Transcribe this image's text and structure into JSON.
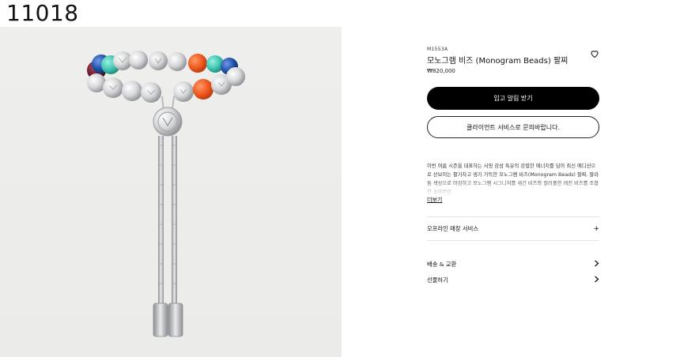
{
  "page": {
    "id_label": "11018"
  },
  "product": {
    "sku": "M1553A",
    "title": "모노그램 비즈 (Monogram Beads) 팔찌",
    "price": "₩820,000"
  },
  "actions": {
    "wishlist_icon": "heart-icon",
    "notify_label": "입고 알림 받기",
    "contact_label": "클라이언트 서비스로 문의바랍니다."
  },
  "description": {
    "text": "이번 여름 시즌을 대표하는 서핑 감성 특유의 강렬한 에너지를 담아 최신 에디션으로 선보이는 활기차고 생기 가득한 모노그램 비즈(Monogram Beads) 팔찌. 팔라듐 색상으로 마감하고 모노그램 시그니처를 새긴 비즈와 컬러풀한 레진 비즈를 조합한 슬라이딩",
    "more_label": "더보기"
  },
  "services": [
    {
      "label": "오프라인 매장 서비스",
      "icon": "plus-icon"
    },
    {
      "label": "배송 & 교환",
      "icon": "chevron-right-icon"
    },
    {
      "label": "선물하기",
      "icon": "chevron-right-icon"
    }
  ],
  "colors": {
    "primary_button": "#000000",
    "bead_orange": "#f0561f",
    "bead_teal": "#3fc4b0",
    "bead_blue": "#1f4fa8",
    "bead_maroon": "#6a1a2a"
  }
}
